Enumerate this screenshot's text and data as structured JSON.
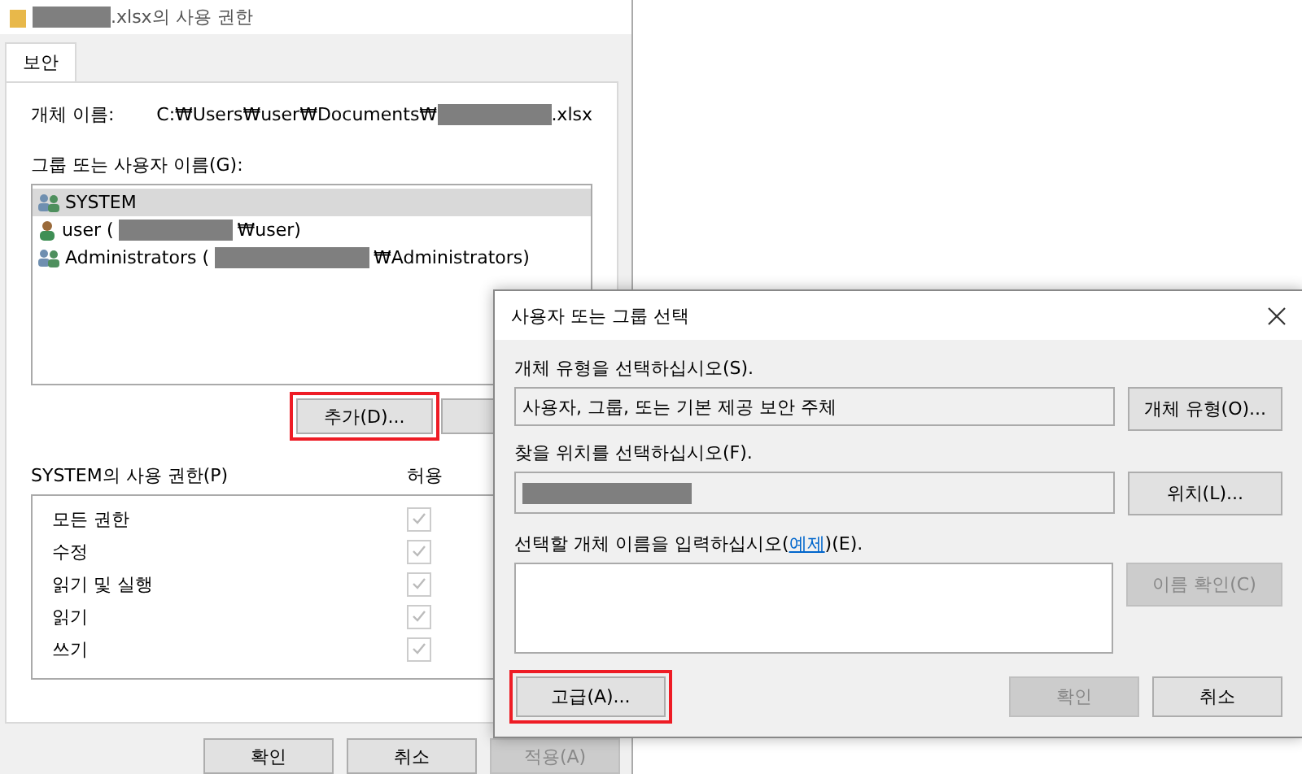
{
  "properties_dialog": {
    "title": [
      {
        "kind": "redacted"
      },
      {
        "kind": "text",
        "text": ".xlsx의 사용 권한"
      }
    ],
    "tabs": [
      {
        "label": "보안",
        "selected": true
      }
    ],
    "object_name_label": "개체 이름:",
    "object_name": [
      {
        "kind": "text",
        "text": "C:₩Users₩user₩Documents₩"
      },
      {
        "kind": "redacted"
      },
      {
        "kind": "text",
        "text": ".xlsx"
      }
    ],
    "principals_label": "그룹 또는 사용자 이름(G):",
    "principals": [
      {
        "kind": "group",
        "selected": true,
        "segments": [
          {
            "kind": "text",
            "text": "SYSTEM"
          }
        ]
      },
      {
        "kind": "user",
        "selected": false,
        "segments": [
          {
            "kind": "text",
            "text": "user ("
          },
          {
            "kind": "redacted"
          },
          {
            "kind": "text",
            "text": "₩user)"
          }
        ]
      },
      {
        "kind": "group",
        "selected": false,
        "segments": [
          {
            "kind": "text",
            "text": "Administrators ("
          },
          {
            "kind": "redacted"
          },
          {
            "kind": "text",
            "text": "₩Administrators)"
          }
        ]
      }
    ],
    "add_button": {
      "label": "추가(D)...",
      "highlighted": true
    },
    "permissions_label": "SYSTEM의 사용 권한(P)",
    "allow_column": "허용",
    "permissions": [
      {
        "name": "모든 권한",
        "checked": true
      },
      {
        "name": "수정",
        "checked": true
      },
      {
        "name": "읽기 및 실행",
        "checked": true
      },
      {
        "name": "읽기",
        "checked": true
      },
      {
        "name": "쓰기",
        "checked": true
      }
    ],
    "buttons": [
      {
        "label": "확인",
        "disabled": false
      },
      {
        "label": "취소",
        "disabled": false
      },
      {
        "label": "적용(A)",
        "disabled": true
      }
    ]
  },
  "select_dialog": {
    "title": "사용자 또는 그룹 선택",
    "object_type_label": "개체 유형을 선택하십시오(S).",
    "object_type_value": "사용자, 그룹, 또는 기본 제공 보안 주체",
    "object_type_button": "개체 유형(O)...",
    "location_label": "찾을 위치를 선택하십시오(F).",
    "location_button": "위치(L)...",
    "names_label": "선택할 개체 이름을 입력하십시오(",
    "names_link": "예제",
    "names_label_end": ")(E).",
    "check_names_button": {
      "label": "이름 확인(C)",
      "disabled": true
    },
    "advanced_button": {
      "label": "고급(A)...",
      "highlighted": true
    },
    "buttons": [
      {
        "label": "확인",
        "disabled": true
      },
      {
        "label": "취소",
        "disabled": false
      }
    ]
  }
}
